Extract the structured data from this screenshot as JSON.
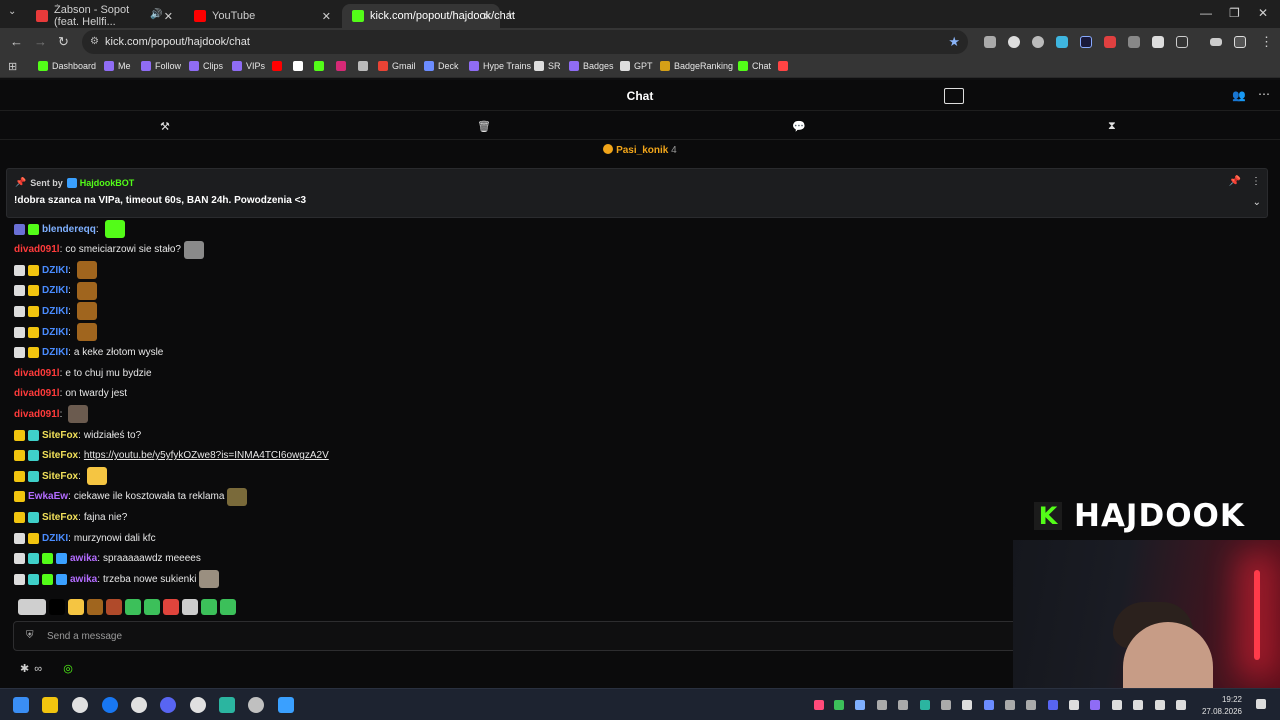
{
  "browser": {
    "tabs": [
      {
        "label": "Żabson - Sopot (feat. Hellfi...",
        "color": "#e83a3a"
      },
      {
        "label": "YouTube",
        "color": "#ff0000"
      },
      {
        "label": "kick.com/popout/hajdook/chat",
        "color": "#53fc18"
      }
    ],
    "new_tab": "+",
    "url": "kick.com/popout/hajdook/chat",
    "bookmarks": [
      {
        "label": "Dashboard",
        "color": "#53fc18"
      },
      {
        "label": "Me",
        "color": "#8f6cf5"
      },
      {
        "label": "Follow",
        "color": "#8f6cf5"
      },
      {
        "label": "Clips",
        "color": "#8f6cf5"
      },
      {
        "label": "VIPs",
        "color": "#8f6cf5"
      },
      {
        "label": "",
        "color": "#ff0000"
      },
      {
        "label": "",
        "color": "#ffffff"
      },
      {
        "label": "",
        "color": "#53fc18"
      },
      {
        "label": "",
        "color": "#d62976"
      },
      {
        "label": "",
        "color": "#bbbbbb"
      },
      {
        "label": "Gmail",
        "color": "#ea4335"
      },
      {
        "label": "Deck",
        "color": "#6b8cff"
      },
      {
        "label": "Hype Trains",
        "color": "#8f6cf5"
      },
      {
        "label": "SR",
        "color": "#dddddd"
      },
      {
        "label": "Badges",
        "color": "#8f6cf5"
      },
      {
        "label": "GPT",
        "color": "#dddddd"
      },
      {
        "label": "BadgeRanking",
        "color": "#d4a017"
      },
      {
        "label": "Chat",
        "color": "#53fc18"
      },
      {
        "label": "",
        "color": "#ff4444"
      }
    ]
  },
  "chat": {
    "title": "Chat",
    "gift": {
      "user": "Pasi_konik",
      "count": "4"
    },
    "pinned": {
      "sent_by_label": "Sent by",
      "sender": "HajdookBOT",
      "message": "!dobra szanca na VIPa, timeout 60s, BAN 24h. Powodzenia <3"
    },
    "messages": [
      {
        "user": "blendereqq",
        "color": "#7fb0ff",
        "text": "",
        "badges": [
          "#6a6fd6",
          "#53fc18"
        ],
        "emote": "#53fc18"
      },
      {
        "user": "divad091l",
        "color": "#ff3b3b",
        "text": "co smeiciarzowi sie stało?",
        "badges": [],
        "emote": "#8a8a8a"
      },
      {
        "user": "DZIKI",
        "color": "#4a8cff",
        "text": "",
        "badges": [
          "#dddddd",
          "#f1c40f"
        ],
        "emote": "#a0651e"
      },
      {
        "user": "DZIKI",
        "color": "#4a8cff",
        "text": "",
        "badges": [
          "#dddddd",
          "#f1c40f"
        ],
        "emote": "#a0651e"
      },
      {
        "user": "DZIKI",
        "color": "#4a8cff",
        "text": "",
        "badges": [
          "#dddddd",
          "#f1c40f"
        ],
        "emote": "#a0651e"
      },
      {
        "user": "DZIKI",
        "color": "#4a8cff",
        "text": "",
        "badges": [
          "#dddddd",
          "#f1c40f"
        ],
        "emote": "#a0651e"
      },
      {
        "user": "DZIKI",
        "color": "#4a8cff",
        "text": "a keke złotom wysle",
        "badges": [
          "#dddddd",
          "#f1c40f"
        ],
        "emote": ""
      },
      {
        "user": "divad091l",
        "color": "#ff3b3b",
        "text": "e to chuj mu bydzie",
        "badges": [],
        "emote": ""
      },
      {
        "user": "divad091l",
        "color": "#ff3b3b",
        "text": "on twardy jest",
        "badges": [],
        "emote": ""
      },
      {
        "user": "divad091l",
        "color": "#ff3b3b",
        "text": "",
        "badges": [],
        "emote": "#6b5b4f"
      },
      {
        "user": "SiteFox",
        "color": "#f1e05a",
        "text": "widziałeś to?",
        "badges": [
          "#f1c40f",
          "#3fd0c9"
        ],
        "emote": ""
      },
      {
        "user": "SiteFox",
        "color": "#f1e05a",
        "text": "https://youtu.be/y5yfykOZwe8?is=INMA4TCI6owgzA2V",
        "badges": [
          "#f1c40f",
          "#3fd0c9"
        ],
        "emote": "",
        "is_link": true
      },
      {
        "user": "SiteFox",
        "color": "#f1e05a",
        "text": "",
        "badges": [
          "#f1c40f",
          "#3fd0c9"
        ],
        "emote": "#f5c542"
      },
      {
        "user": "EwkaEw",
        "color": "#b36cff",
        "text": "ciekawe ile kosztowała ta reklama",
        "badges": [
          "#f1c40f"
        ],
        "emote": "#7a6a3a"
      },
      {
        "user": "SiteFox",
        "color": "#f1e05a",
        "text": "fajna nie?",
        "badges": [
          "#f1c40f",
          "#3fd0c9"
        ],
        "emote": ""
      },
      {
        "user": "DZIKI",
        "color": "#4a8cff",
        "text": "murzynowi dali kfc",
        "badges": [
          "#dddddd",
          "#f1c40f"
        ],
        "emote": ""
      },
      {
        "user": "awika",
        "color": "#b36cff",
        "text": "spraaaaawdz meeees",
        "badges": [
          "#dddddd",
          "#3fd0c9",
          "#53fc18",
          "#3aa0ff"
        ],
        "emote": ""
      },
      {
        "user": "awika",
        "color": "#b36cff",
        "text": "trzeba nowe sukienki",
        "badges": [
          "#dddddd",
          "#3fd0c9",
          "#53fc18",
          "#3aa0ff"
        ],
        "emote": "#9a8f80"
      }
    ],
    "emote_bar": [
      "#cfcfcf",
      "#000000",
      "#f5c542",
      "#a0651e",
      "#b04a2a",
      "#3cc05a",
      "#3cc05a",
      "#e0443c",
      "#cccccc",
      "#3cc05a",
      "#3cc05a"
    ],
    "input_placeholder": "Send a message"
  },
  "overlay": {
    "channel_name": "HAJDOOK",
    "logo_letter": "K"
  },
  "taskbar": {
    "time": "19:22",
    "date": "27.08.2026"
  }
}
